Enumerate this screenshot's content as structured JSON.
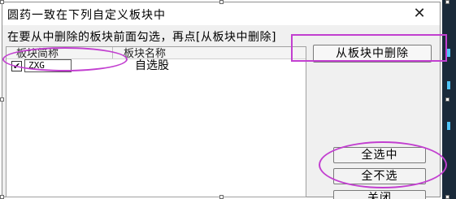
{
  "dialog": {
    "title": "圆药一致在下列自定义板块中",
    "close_glyph": "✕",
    "instruction": "在要从中删除的板块前面勾选，再点[从板块中删除]"
  },
  "list": {
    "columns": [
      "板块简称",
      "板块名称"
    ],
    "rows": [
      {
        "checked": true,
        "check_glyph": "✔",
        "code": "ZXG",
        "name": "自选股"
      }
    ]
  },
  "buttons": {
    "delete_label": "从板块中删除",
    "select_all_label": "全选中",
    "deselect_all_label": "全不选",
    "close_label": "关闭"
  },
  "colors": {
    "annotation": "#c23fd0",
    "strip": "#1a2a3a",
    "strip_accent": "#4fc3f7"
  }
}
